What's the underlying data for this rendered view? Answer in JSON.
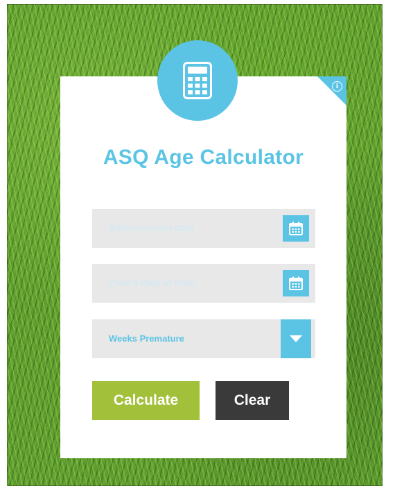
{
  "title": "ASQ Age Calculator",
  "info_icon_glyph": "i",
  "fields": {
    "administration_date": {
      "placeholder": "Administration Date",
      "icon": "calendar-icon"
    },
    "child_dob": {
      "placeholder": "Child's Date of Birth",
      "icon": "calendar-icon"
    },
    "weeks_premature": {
      "selected": "Weeks Premature",
      "icon": "chevron-down-icon"
    }
  },
  "buttons": {
    "calculate": "Calculate",
    "clear": "Clear"
  },
  "colors": {
    "accent": "#5bc4e4",
    "calculate": "#a3c03b",
    "clear": "#3a3a3a",
    "field_bg": "#e8e8e8"
  }
}
